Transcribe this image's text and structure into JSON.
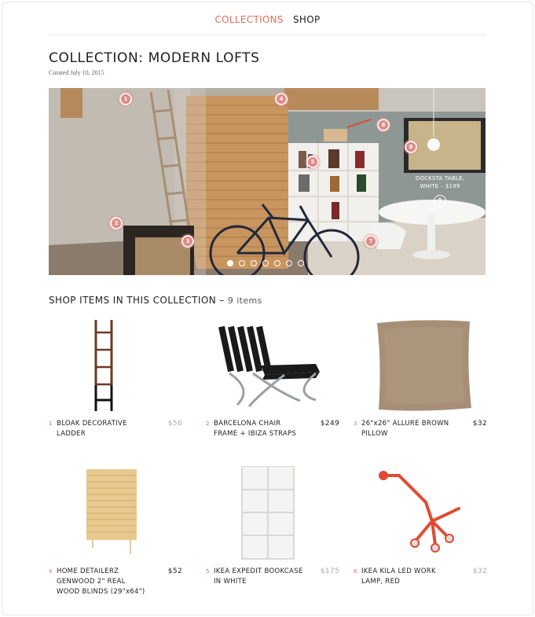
{
  "nav": {
    "collections": "COLLECTIONS",
    "shop": "SHOP"
  },
  "header": {
    "title": "COLLECTION: MODERN LOFTS",
    "curated": "Curated July 10, 2015"
  },
  "hero": {
    "hotspots": [
      "1",
      "2",
      "3",
      "4",
      "5",
      "6",
      "7",
      "8",
      "9"
    ],
    "tooltip_line1": "DOCKSTA TABLE,",
    "tooltip_line2": "WHITE – $199",
    "slides": 7,
    "active_slide": 1
  },
  "section": {
    "heading": "SHOP ITEMS IN THIS COLLECTION –",
    "count": "9 items"
  },
  "items": [
    {
      "num": "1",
      "name": "BLOAK DECORATIVE LADDER",
      "price": "$56",
      "price_muted": true
    },
    {
      "num": "2",
      "name": "BARCELONA CHAIR FRAME + IBIZA STRAPS",
      "price": "$249",
      "price_muted": false
    },
    {
      "num": "3",
      "name": "26\"x26\" ALLURE BROWN PILLOW",
      "price": "$32",
      "price_muted": false
    },
    {
      "num": "4",
      "name": "HOME DETAILERZ GENWOOD 2\" REAL WOOD BLINDS (29\"x64\")",
      "price": "$52",
      "price_muted": false
    },
    {
      "num": "5",
      "name": "IKEA EXPEDIT BOOKCASE IN WHITE",
      "price": "$175",
      "price_muted": true
    },
    {
      "num": "6",
      "name": "IKEA KILA LED WORK LAMP, RED",
      "price": "$32",
      "price_muted": true
    }
  ],
  "colors": {
    "accent": "#e26d5a",
    "hotspot": "#e08a86"
  }
}
